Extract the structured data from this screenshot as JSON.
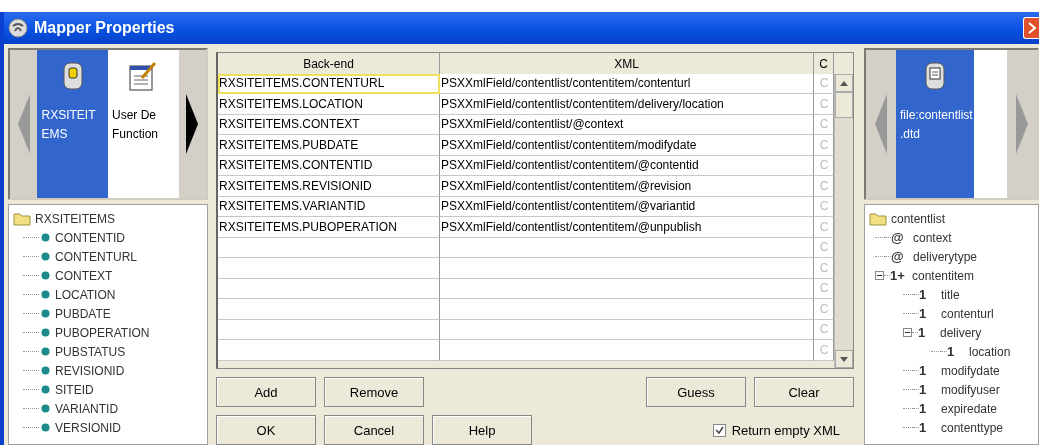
{
  "window": {
    "title": "Mapper Properties"
  },
  "source_carousel": {
    "items": [
      {
        "lines": [
          "RXSITEIT",
          "EMS"
        ],
        "selected": true,
        "kind": "database"
      },
      {
        "lines": [
          "User De",
          "Function"
        ],
        "selected": false,
        "kind": "function"
      }
    ]
  },
  "source_tree": {
    "label": "RXSITEITEMS",
    "children": [
      {
        "label": "CONTENTID"
      },
      {
        "label": "CONTENTURL"
      },
      {
        "label": "CONTEXT"
      },
      {
        "label": "LOCATION"
      },
      {
        "label": "PUBDATE"
      },
      {
        "label": "PUBOPERATION"
      },
      {
        "label": "PUBSTATUS"
      },
      {
        "label": "REVISIONID"
      },
      {
        "label": "SITEID"
      },
      {
        "label": "VARIANTID"
      },
      {
        "label": "VERSIONID"
      }
    ]
  },
  "table": {
    "columns": [
      "Back-end",
      "XML",
      "C"
    ],
    "rows": [
      {
        "back_end": "RXSITEITEMS.CONTENTURL",
        "xml": "PSXXmlField/contentlist/contentitem/contenturl",
        "c": "C",
        "selected": true
      },
      {
        "back_end": "RXSITEITEMS.LOCATION",
        "xml": "PSXXmlField/contentlist/contentitem/delivery/location",
        "c": "C",
        "selected": false
      },
      {
        "back_end": "RXSITEITEMS.CONTEXT",
        "xml": "PSXXmlField/contentlist/@context",
        "c": "C",
        "selected": false
      },
      {
        "back_end": "RXSITEITEMS.PUBDATE",
        "xml": "PSXXmlField/contentlist/contentitem/modifydate",
        "c": "C",
        "selected": false
      },
      {
        "back_end": "RXSITEITEMS.CONTENTID",
        "xml": "PSXXmlField/contentlist/contentitem/@contentid",
        "c": "C",
        "selected": false
      },
      {
        "back_end": "RXSITEITEMS.REVISIONID",
        "xml": "PSXXmlField/contentlist/contentitem/@revision",
        "c": "C",
        "selected": false
      },
      {
        "back_end": "RXSITEITEMS.VARIANTID",
        "xml": "PSXXmlField/contentlist/contentitem/@variantid",
        "c": "C",
        "selected": false
      },
      {
        "back_end": "RXSITEITEMS.PUBOPERATION",
        "xml": "PSXXmlField/contentlist/contentitem/@unpublish",
        "c": "C",
        "selected": false
      },
      {
        "c": "C",
        "selected": false
      },
      {
        "c": "C",
        "selected": false
      },
      {
        "c": "C",
        "selected": false
      },
      {
        "c": "C",
        "selected": false
      },
      {
        "c": "C",
        "selected": false
      },
      {
        "c": "C",
        "selected": false
      }
    ]
  },
  "buttons_row1_left": [
    "Add",
    "Remove"
  ],
  "buttons_row1_right": [
    "Guess",
    "Clear"
  ],
  "buttons_row2": [
    "OK",
    "Cancel",
    "Help"
  ],
  "return_empty_xml": {
    "label": "Return empty XML",
    "checked": true
  },
  "target_carousel": {
    "items": [
      {
        "lines": [
          "file:contentlist",
          ".dtd"
        ],
        "selected": true,
        "kind": "document"
      }
    ]
  },
  "target_tree": {
    "label": "contentlist",
    "children": [
      {
        "marker": "@",
        "label": "context"
      },
      {
        "marker": "@",
        "label": "deliverytype"
      },
      {
        "marker": "1+",
        "label": "contentitem",
        "expanded": true,
        "children": [
          {
            "marker": "1",
            "label": "title"
          },
          {
            "marker": "1",
            "label": "contenturl"
          },
          {
            "marker": "1",
            "label": "delivery",
            "expanded": true,
            "children": [
              {
                "marker": "1",
                "label": "location"
              }
            ]
          },
          {
            "marker": "1",
            "label": "modifydate"
          },
          {
            "marker": "1",
            "label": "modifyuser"
          },
          {
            "marker": "1",
            "label": "expiredate"
          },
          {
            "marker": "1",
            "label": "contenttype"
          }
        ]
      }
    ]
  }
}
